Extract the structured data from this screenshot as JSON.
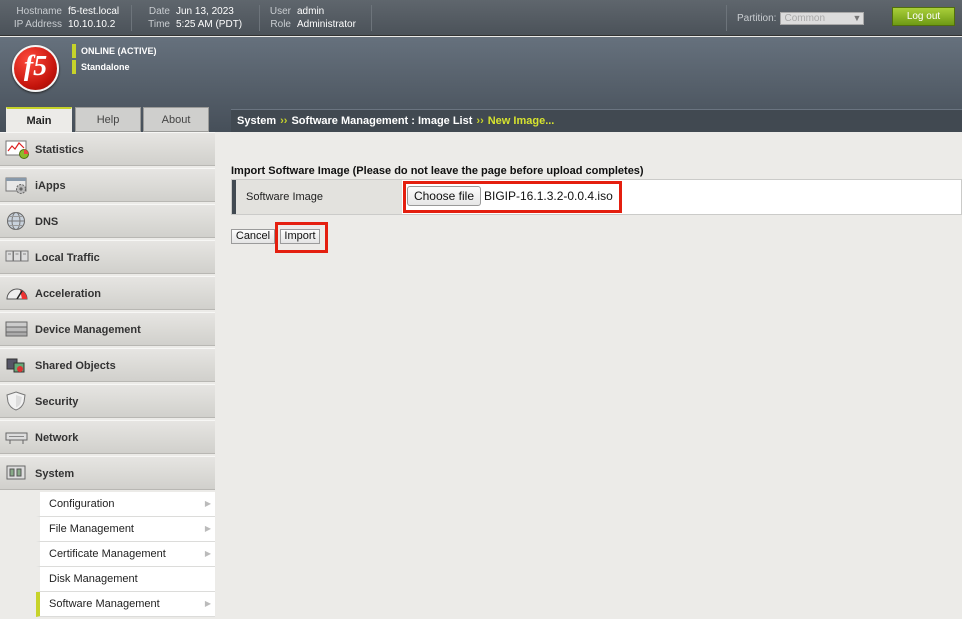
{
  "topbar": {
    "hostname_key": "Hostname",
    "hostname": "f5-test.local",
    "ip_key": "IP Address",
    "ip": "10.10.10.2",
    "date_key": "Date",
    "date": "Jun 13, 2023",
    "time_key": "Time",
    "time": "5:25 AM (PDT)",
    "user_key": "User",
    "user": "admin",
    "role_key": "Role",
    "role": "Administrator",
    "partition_label": "Partition:",
    "partition_value": "Common",
    "logout_label": "Log out"
  },
  "header": {
    "logo_text": "f5",
    "status": "ONLINE (ACTIVE)",
    "mode": "Standalone",
    "accent_color": "#c7d32a"
  },
  "tabs": [
    {
      "label": "Main",
      "active": true
    },
    {
      "label": "Help",
      "active": false
    },
    {
      "label": "About",
      "active": false
    }
  ],
  "breadcrumb": {
    "items": [
      "System",
      "Software Management : Image List"
    ],
    "separator": "››",
    "current": "New Image..."
  },
  "sidebar": {
    "items": [
      {
        "label": "Statistics",
        "icon": "statistics-chart-icon"
      },
      {
        "label": "iApps",
        "icon": "iapps-gear-icon"
      },
      {
        "label": "DNS",
        "icon": "dns-globe-icon"
      },
      {
        "label": "Local Traffic",
        "icon": "local-traffic-icon"
      },
      {
        "label": "Acceleration",
        "icon": "acceleration-gauge-icon"
      },
      {
        "label": "Device Management",
        "icon": "device-server-icon"
      },
      {
        "label": "Shared Objects",
        "icon": "shared-objects-icon"
      },
      {
        "label": "Security",
        "icon": "security-shield-icon"
      },
      {
        "label": "Network",
        "icon": "network-icon"
      },
      {
        "label": "System",
        "icon": "system-icon"
      }
    ],
    "submenu": [
      {
        "label": "Configuration",
        "has_arrow": true
      },
      {
        "label": "File Management",
        "has_arrow": true
      },
      {
        "label": "Certificate Management",
        "has_arrow": true
      },
      {
        "label": "Disk Management",
        "has_arrow": false
      },
      {
        "label": "Software Management",
        "has_arrow": true,
        "active": true
      }
    ]
  },
  "form": {
    "title": "Import Software Image (Please do not leave the page before upload completes)",
    "field_label": "Software Image",
    "choose_file_label": "Choose file",
    "file_name": "BIGIP-16.1.3.2-0.0.4.iso",
    "cancel_label": "Cancel",
    "import_label": "Import",
    "highlight_color": "#e41f0f"
  }
}
